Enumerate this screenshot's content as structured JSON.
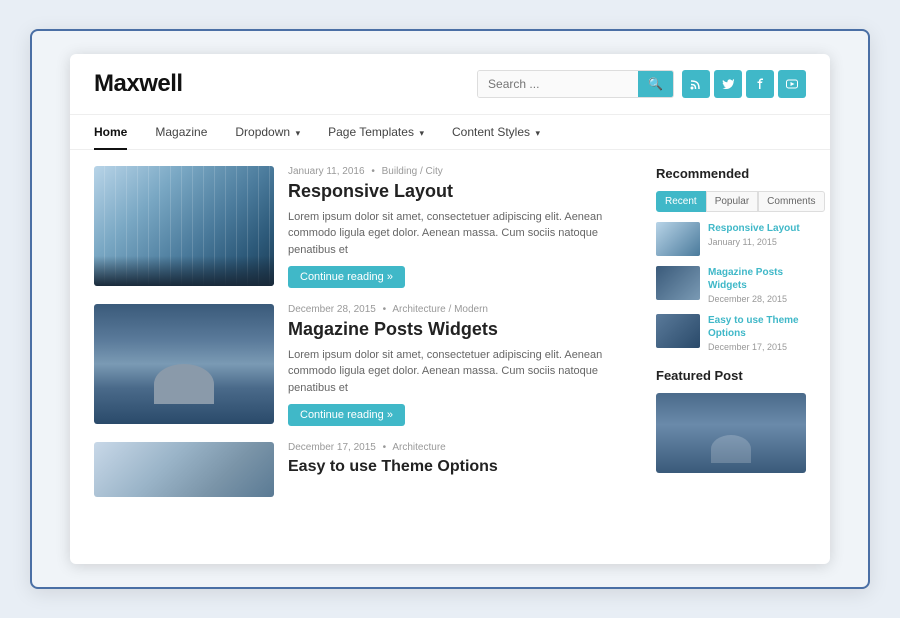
{
  "site": {
    "title": "Maxwell",
    "search_placeholder": "Search ...",
    "nav": {
      "items": [
        {
          "label": "Home",
          "active": true,
          "has_dropdown": false
        },
        {
          "label": "Magazine",
          "active": false,
          "has_dropdown": false
        },
        {
          "label": "Dropdown",
          "active": false,
          "has_dropdown": true
        },
        {
          "label": "Page Templates",
          "active": false,
          "has_dropdown": true
        },
        {
          "label": "Content Styles",
          "active": false,
          "has_dropdown": true
        }
      ]
    },
    "social": {
      "rss": "RSS",
      "twitter": "t",
      "facebook": "f",
      "youtube": "▶"
    }
  },
  "posts": [
    {
      "date": "January 11, 2016",
      "category": "Building / City",
      "title": "Responsive Layout",
      "excerpt": "Lorem ipsum dolor sit amet, consectetuer adipiscing elit. Aenean commodo ligula eget dolor. Aenean massa. Cum sociis natoque penatibus et",
      "read_more": "Continue reading »",
      "image_type": "building"
    },
    {
      "date": "December 28, 2015",
      "category": "Architecture / Modern",
      "title": "Magazine Posts Widgets",
      "excerpt": "Lorem ipsum dolor sit amet, consectetuer adipiscing elit. Aenean commodo ligula eget dolor. Aenean massa. Cum sociis natoque penatibus et",
      "read_more": "Continue reading »",
      "image_type": "observatory"
    },
    {
      "date": "December 17, 2015",
      "category": "Architecture",
      "title": "Easy to use Theme Options",
      "excerpt": "",
      "read_more": "",
      "image_type": "flowers"
    }
  ],
  "sidebar": {
    "recommended": {
      "title": "Recommended",
      "tabs": [
        "Recent",
        "Popular",
        "Comments"
      ],
      "active_tab": "Recent",
      "items": [
        {
          "title": "Responsive Layout",
          "date": "January 11, 2015",
          "image_type": "rec1"
        },
        {
          "title": "Magazine Posts Widgets",
          "date": "December 28, 2015",
          "image_type": "rec2"
        },
        {
          "title": "Easy to use Theme Options",
          "date": "December 17, 2015",
          "image_type": "rec3"
        }
      ]
    },
    "featured": {
      "title": "Featured Post"
    }
  }
}
